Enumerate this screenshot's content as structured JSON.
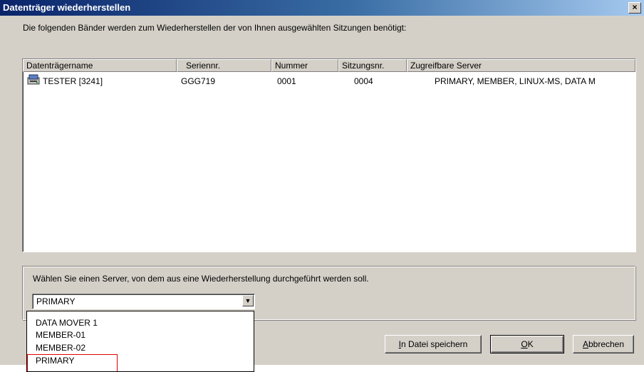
{
  "window": {
    "title": "Datenträger wiederherstellen",
    "close_glyph": "×"
  },
  "info_text": "Die folgenden Bänder werden zum Wiederherstellen der von Ihnen ausgewählten Sitzungen benötigt:",
  "table": {
    "columns": [
      "Datenträgername",
      "Seriennr.",
      "Nummer",
      "Sitzungsnr.",
      "Zugreifbare Server"
    ],
    "rows": [
      {
        "icon": "tape-drive-icon",
        "name": "TESTER [3241]",
        "serial": "GGG719",
        "number": "0001",
        "session": "0004",
        "servers": "PRIMARY, MEMBER, LINUX-MS, DATA M"
      }
    ]
  },
  "server_group": {
    "label": "Wählen Sie einen Server, von dem aus eine Wiederherstellung durchgeführt werden soll.",
    "selected": "PRIMARY",
    "options": [
      "DATA MOVER 1",
      "MEMBER-01",
      "MEMBER-02",
      "PRIMARY"
    ]
  },
  "buttons": {
    "save_key": "I",
    "save_rest": "n Datei speichern",
    "ok_key": "O",
    "ok_rest": "K",
    "cancel_key": "A",
    "cancel_rest": "bbrechen"
  },
  "colors": {
    "title_start": "#0a246a",
    "title_end": "#a6caf0",
    "dialog_bg": "#d4d0c8",
    "highlight_border": "#e00000"
  }
}
